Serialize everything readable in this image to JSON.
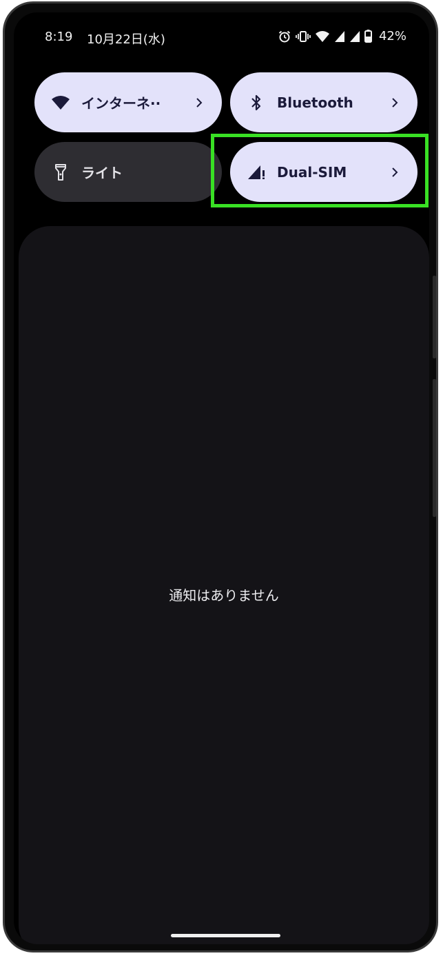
{
  "status_bar": {
    "time": "8:19",
    "date": "10月22日(水)",
    "battery_percent": "42%",
    "icons": [
      "alarm-icon",
      "vibrate-icon",
      "wifi-icon",
      "signal-icon",
      "signal-icon",
      "battery-icon"
    ]
  },
  "quick_settings": {
    "tiles": [
      {
        "label": "インターネ··",
        "icon": "wifi-icon",
        "state": "on"
      },
      {
        "label": "Bluetooth",
        "icon": "bluetooth-icon",
        "state": "on"
      },
      {
        "label": "ライト",
        "icon": "flashlight-icon",
        "state": "off"
      },
      {
        "label": "Dual-SIM",
        "icon": "signal-alert-icon",
        "state": "on"
      }
    ]
  },
  "notifications": {
    "empty_text": "通知はありません"
  },
  "colors": {
    "tile_on": "#e3e2fa",
    "tile_off": "#2e2d32",
    "highlight": "#39e024",
    "panel": "#141317"
  }
}
